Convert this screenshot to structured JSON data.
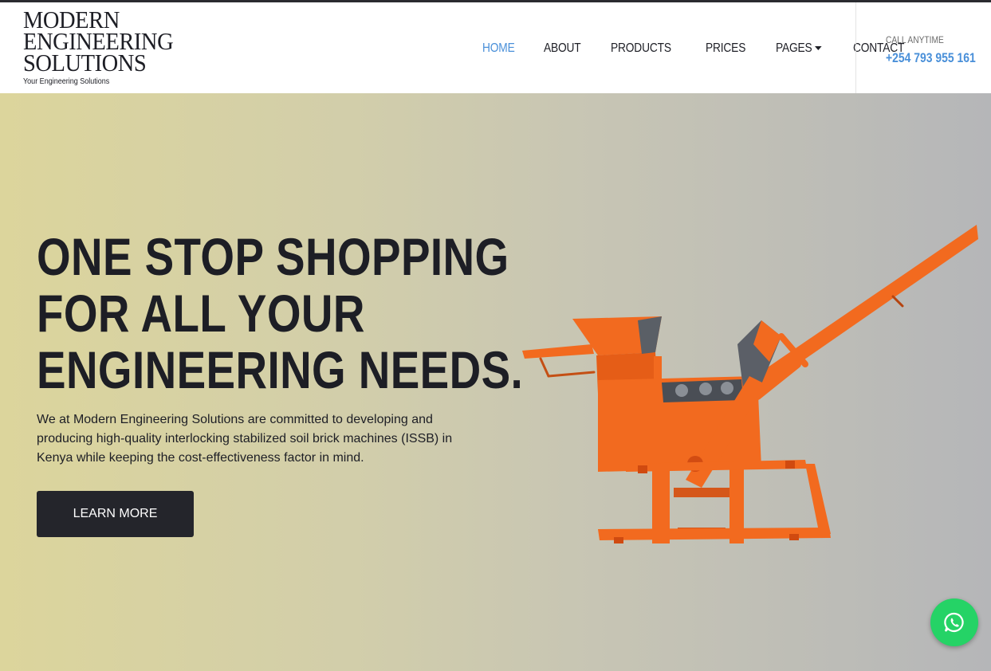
{
  "logo": {
    "line1": "MODERN",
    "line2": "ENGINEERING",
    "line3": "SOLUTIONS",
    "tagline": "Your Engineering Solutions"
  },
  "nav": {
    "items": [
      {
        "label": "HOME",
        "active": true
      },
      {
        "label": "ABOUT",
        "active": false
      },
      {
        "label": "PRODUCTS",
        "active": false
      },
      {
        "label": "PRICES",
        "active": false
      },
      {
        "label": "PAGES",
        "active": false,
        "dropdown": true
      },
      {
        "label": "CONTACT",
        "active": false
      }
    ]
  },
  "call": {
    "label": "CALL ANYTIME",
    "phone": "+254 793 955 161"
  },
  "hero": {
    "title_line1": "ONE STOP SHOPPING",
    "title_line2": "FOR ALL YOUR",
    "title_line3": "ENGINEERING NEEDS.",
    "description": "We at Modern Engineering Solutions are committed to developing and producing high-quality interlocking stabilized soil brick machines (ISSB) in Kenya while keeping the cost-effectiveness factor in mind.",
    "button_label": "LEARN MORE"
  },
  "icons": {
    "whatsapp": "whatsapp-icon",
    "caret": "caret-down-icon"
  },
  "colors": {
    "accent": "#4a90d9",
    "dark": "#1d1e25",
    "button": "#24252b",
    "machine": "#f26a1f",
    "whatsapp": "#25d366"
  }
}
